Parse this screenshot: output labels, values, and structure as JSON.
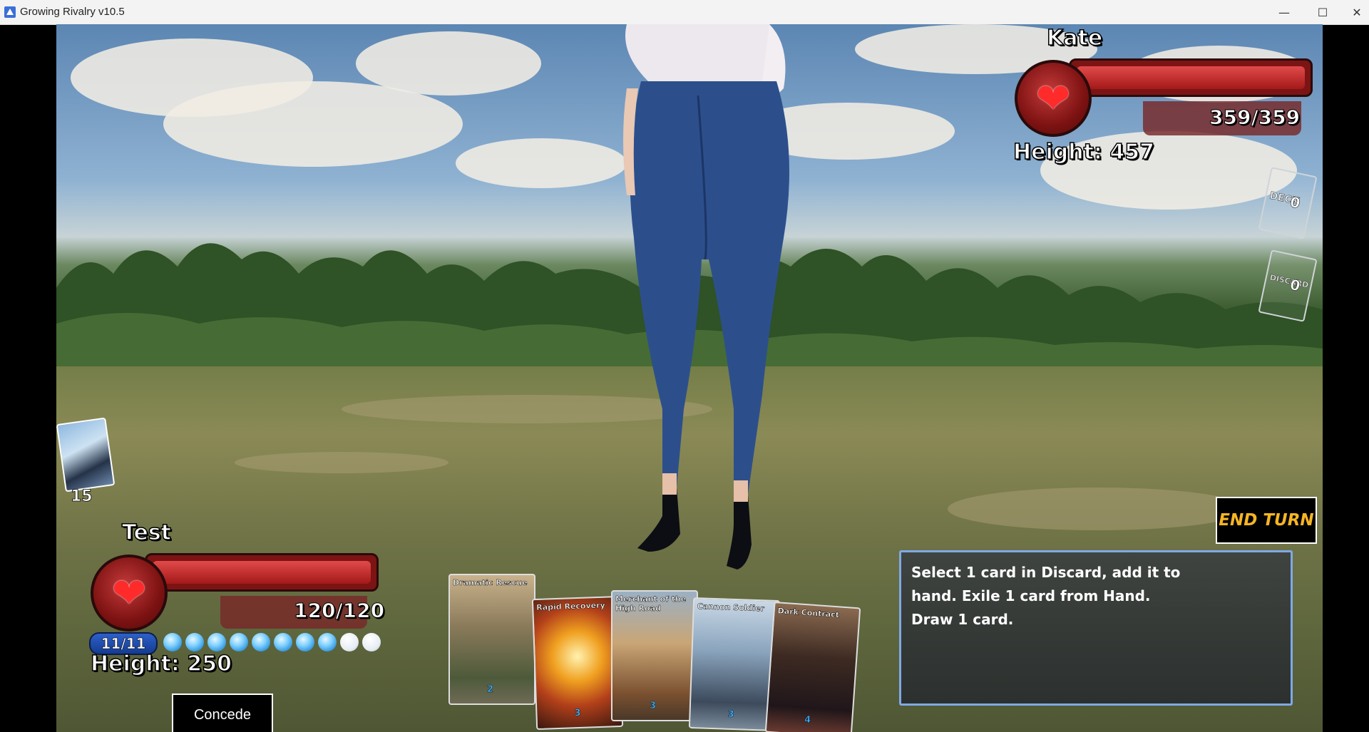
{
  "window": {
    "title": "Growing Rivalry v10.5",
    "controls": [
      "minimize-icon",
      "maximize-icon",
      "close-icon"
    ]
  },
  "opponent": {
    "name": "Kate",
    "hp": "359/359",
    "hp_fraction": 1.0,
    "height": "Height: 457"
  },
  "piles": {
    "deck_label": "DECK",
    "deck_count": "0",
    "discard_label": "DISCARD",
    "discard_count": "0"
  },
  "player": {
    "name": "Test",
    "hp": "120/120",
    "hp_fraction": 1.0,
    "height": "Height: 250",
    "deck_count": "15",
    "energy": "11/11",
    "energy_gems_total": 10,
    "energy_gems_filled": 8
  },
  "hand": [
    {
      "name": "Dramatic Rescue",
      "cost": "2"
    },
    {
      "name": "Rapid Recovery",
      "cost": "3"
    },
    {
      "name": "Merchant of the High Road",
      "cost": "3"
    },
    {
      "name": "Cannon Soldier",
      "cost": "3"
    },
    {
      "name": "Dark Contract",
      "cost": "4"
    }
  ],
  "buttons": {
    "end_turn": "END TURN",
    "concede": "Concede"
  },
  "card_description": "Select 1 card in Discard, add it to hand. Exile 1 card from Hand. Draw 1 card.",
  "colors": {
    "hp_red": "#c62828",
    "end_turn_text": "#f5b523",
    "energy_blue": "#2e60c9",
    "desc_border": "#7fa9e6"
  }
}
